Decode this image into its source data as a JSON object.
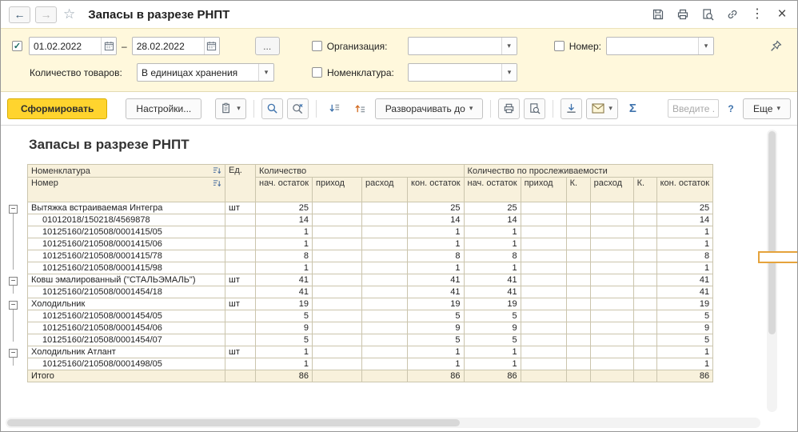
{
  "colors": {
    "filter_panel_bg": "#fff8dc",
    "generate_button_bg": "#ffd42e",
    "table_header_bg": "#f8f1dc",
    "selection_border": "#e5a33b"
  },
  "titlebar": {
    "title": "Запасы в разрезе РНПТ",
    "back_icon": "←",
    "forward_icon": "→",
    "star_icon": "☆",
    "menu_icon": "⋮",
    "close_icon": "×"
  },
  "filter_panel": {
    "check_icon": "✓",
    "date_from": "01.02.2022",
    "range_dash": "–",
    "date_to": "28.02.2022",
    "period_more_button": "...",
    "qty_label": "Количество товаров:",
    "qty_value": "В единицах хранения",
    "org_label": "Организация:",
    "nomenclature_label": "Номенклатура:",
    "number_label": "Номер:",
    "dropdown_icon": "▾"
  },
  "toolbar": {
    "generate_button": "Сформировать",
    "settings_button": "Настройки...",
    "expand_to_button": "Разворачивать до",
    "dropdown_icon": "▾",
    "sum_button": "Σ",
    "quick_input_placeholder": "Введите ...",
    "help_button": "?",
    "more_button": "Еще"
  },
  "report": {
    "title": "Запасы в разрезе РНПТ",
    "collapse_icon": "−",
    "header": {
      "nomenclature": "Номенклатура",
      "number": "Номер",
      "unit": "Ед.",
      "qty_group": "Количество",
      "traceability_group": "Количество по прослеживаемости",
      "subcolumns": [
        "нач. остаток",
        "приход",
        "расход",
        "кон. остаток",
        "нач. остаток",
        "приход",
        "К.",
        "расход",
        "К.",
        "кон. остаток"
      ]
    },
    "rows": [
      {
        "type": "group",
        "name": "Вытяжка встраиваемая Интегра",
        "unit": "шт",
        "values": [
          "25",
          "",
          "",
          "25",
          "25",
          "",
          "",
          "",
          "",
          "25"
        ]
      },
      {
        "type": "detail",
        "name": "01012018/150218/4569878",
        "unit": "",
        "values": [
          "14",
          "",
          "",
          "14",
          "14",
          "",
          "",
          "",
          "",
          "14"
        ]
      },
      {
        "type": "detail",
        "name": "10125160/210508/0001415/05",
        "unit": "",
        "values": [
          "1",
          "",
          "",
          "1",
          "1",
          "",
          "",
          "",
          "",
          "1"
        ]
      },
      {
        "type": "detail",
        "name": "10125160/210508/0001415/06",
        "unit": "",
        "values": [
          "1",
          "",
          "",
          "1",
          "1",
          "",
          "",
          "",
          "",
          "1"
        ]
      },
      {
        "type": "detail",
        "name": "10125160/210508/0001415/78",
        "unit": "",
        "values": [
          "8",
          "",
          "",
          "8",
          "8",
          "",
          "",
          "",
          "",
          "8"
        ]
      },
      {
        "type": "detail",
        "name": "10125160/210508/0001415/98",
        "unit": "",
        "values": [
          "1",
          "",
          "",
          "1",
          "1",
          "",
          "",
          "",
          "",
          "1"
        ]
      },
      {
        "type": "group",
        "name": "Ковш эмалированный (\"СТАЛЬЭМАЛЬ\")",
        "unit": "шт",
        "values": [
          "41",
          "",
          "",
          "41",
          "41",
          "",
          "",
          "",
          "",
          "41"
        ]
      },
      {
        "type": "detail",
        "name": "10125160/210508/0001454/18",
        "unit": "",
        "values": [
          "41",
          "",
          "",
          "41",
          "41",
          "",
          "",
          "",
          "",
          "41"
        ]
      },
      {
        "type": "group",
        "name": "Холодильник",
        "unit": "шт",
        "values": [
          "19",
          "",
          "",
          "19",
          "19",
          "",
          "",
          "",
          "",
          "19"
        ]
      },
      {
        "type": "detail",
        "name": "10125160/210508/0001454/05",
        "unit": "",
        "values": [
          "5",
          "",
          "",
          "5",
          "5",
          "",
          "",
          "",
          "",
          "5"
        ]
      },
      {
        "type": "detail",
        "name": "10125160/210508/0001454/06",
        "unit": "",
        "values": [
          "9",
          "",
          "",
          "9",
          "9",
          "",
          "",
          "",
          "",
          "9"
        ]
      },
      {
        "type": "detail",
        "name": "10125160/210508/0001454/07",
        "unit": "",
        "values": [
          "5",
          "",
          "",
          "5",
          "5",
          "",
          "",
          "",
          "",
          "5"
        ]
      },
      {
        "type": "group",
        "name": "Холодильник Атлант",
        "unit": "шт",
        "values": [
          "1",
          "",
          "",
          "1",
          "1",
          "",
          "",
          "",
          "",
          "1"
        ]
      },
      {
        "type": "detail",
        "name": "10125160/210508/0001498/05",
        "unit": "",
        "values": [
          "1",
          "",
          "",
          "1",
          "1",
          "",
          "",
          "",
          "",
          "1"
        ]
      },
      {
        "type": "total",
        "name": "Итого",
        "unit": "",
        "values": [
          "86",
          "",
          "",
          "86",
          "86",
          "",
          "",
          "",
          "",
          "86"
        ]
      }
    ]
  }
}
